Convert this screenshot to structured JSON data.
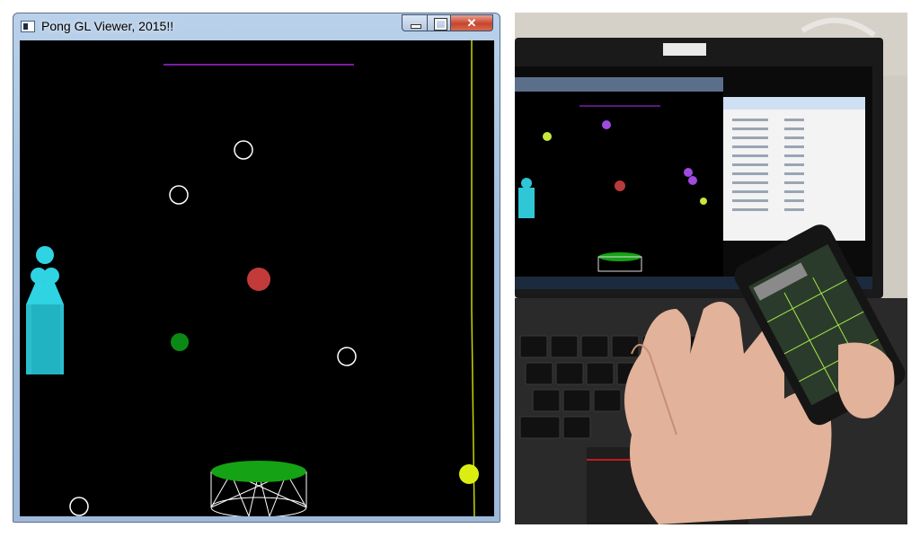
{
  "window": {
    "title": "Pong GL Viewer, 2015!!",
    "controls": {
      "minimize": "minimize",
      "maximize": "maximize",
      "close": "✕"
    }
  },
  "colors": {
    "background": "#000000",
    "paddle_top": "#7a1fa2",
    "right_wall": "#c8d400",
    "player": "#2fd3e2",
    "red_ball": "#c23a3a",
    "green_ball": "#0a8a14",
    "yellow_ball": "#dbee12",
    "drum_top": "#15a215"
  },
  "icons": {
    "app": "app-window-icon",
    "minimize": "minimize-icon",
    "maximize": "maximize-icon",
    "close": "close-icon"
  }
}
